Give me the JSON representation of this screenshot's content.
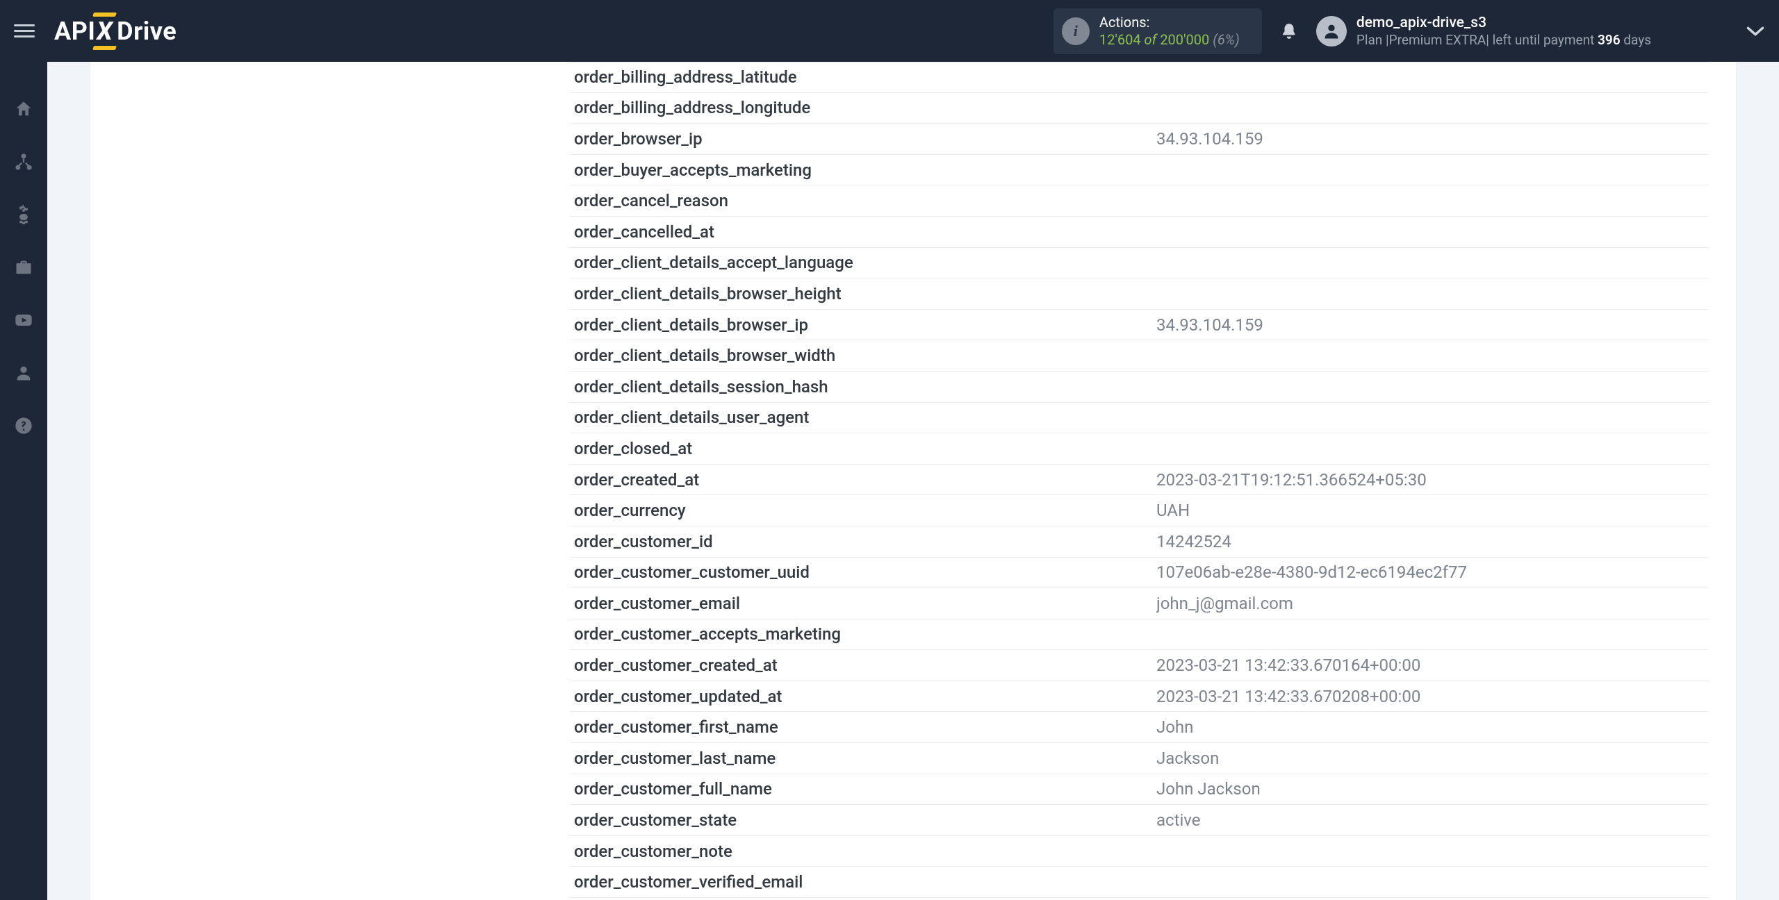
{
  "header": {
    "logo_parts": {
      "api": "API",
      "x": "X",
      "drive": "Drive"
    },
    "actions": {
      "label": "Actions:",
      "used": "12'604",
      "of": "of",
      "total": "200'000",
      "pct": "(6%)"
    },
    "user": {
      "name": "demo_apix-drive_s3",
      "plan_prefix": "Plan |",
      "plan_name": "Premium EXTRA",
      "plan_mid": "| left until payment ",
      "days": "396",
      "plan_suffix": " days"
    }
  },
  "rows": [
    {
      "key": "order_billing_address_latitude",
      "val": ""
    },
    {
      "key": "order_billing_address_longitude",
      "val": ""
    },
    {
      "key": "order_browser_ip",
      "val": "34.93.104.159"
    },
    {
      "key": "order_buyer_accepts_marketing",
      "val": ""
    },
    {
      "key": "order_cancel_reason",
      "val": ""
    },
    {
      "key": "order_cancelled_at",
      "val": ""
    },
    {
      "key": "order_client_details_accept_language",
      "val": ""
    },
    {
      "key": "order_client_details_browser_height",
      "val": ""
    },
    {
      "key": "order_client_details_browser_ip",
      "val": "34.93.104.159"
    },
    {
      "key": "order_client_details_browser_width",
      "val": ""
    },
    {
      "key": "order_client_details_session_hash",
      "val": ""
    },
    {
      "key": "order_client_details_user_agent",
      "val": ""
    },
    {
      "key": "order_closed_at",
      "val": ""
    },
    {
      "key": "order_created_at",
      "val": "2023-03-21T19:12:51.366524+05:30"
    },
    {
      "key": "order_currency",
      "val": "UAH"
    },
    {
      "key": "order_customer_id",
      "val": "14242524"
    },
    {
      "key": "order_customer_customer_uuid",
      "val": "107e06ab-e28e-4380-9d12-ec6194ec2f77"
    },
    {
      "key": "order_customer_email",
      "val": "john_j@gmail.com"
    },
    {
      "key": "order_customer_accepts_marketing",
      "val": ""
    },
    {
      "key": "order_customer_created_at",
      "val": "2023-03-21 13:42:33.670164+00:00"
    },
    {
      "key": "order_customer_updated_at",
      "val": "2023-03-21 13:42:33.670208+00:00"
    },
    {
      "key": "order_customer_first_name",
      "val": "John"
    },
    {
      "key": "order_customer_last_name",
      "val": "Jackson"
    },
    {
      "key": "order_customer_full_name",
      "val": "John Jackson"
    },
    {
      "key": "order_customer_state",
      "val": "active"
    },
    {
      "key": "order_customer_note",
      "val": ""
    },
    {
      "key": "order_customer_verified_email",
      "val": ""
    }
  ]
}
